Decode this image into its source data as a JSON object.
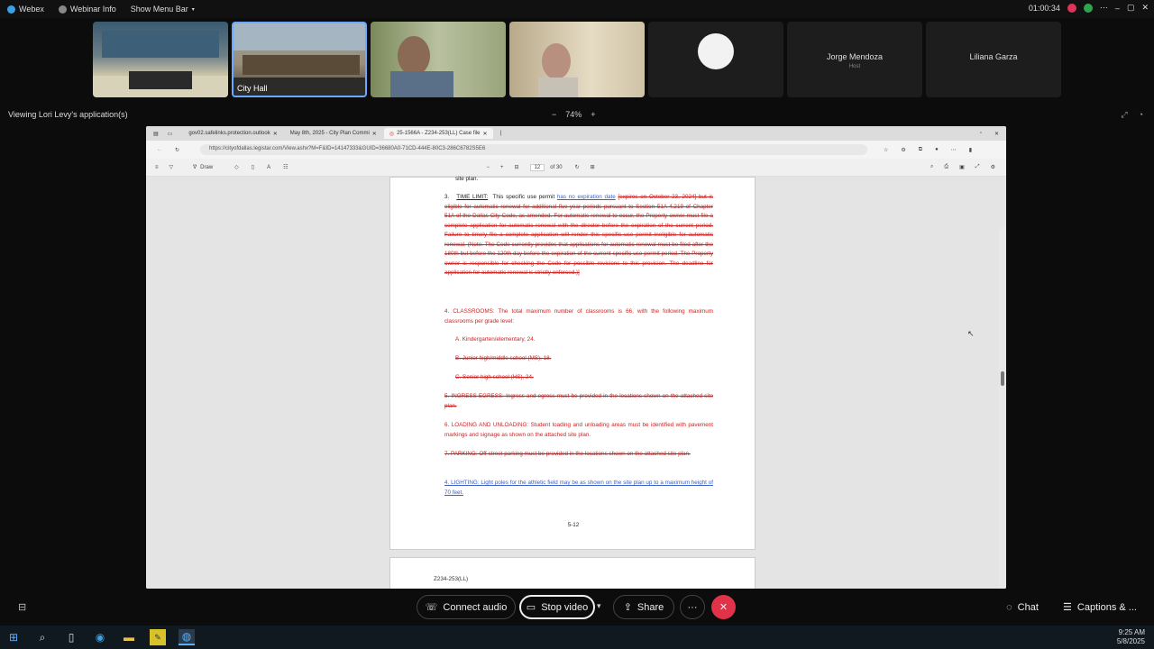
{
  "topbar": {
    "menus": [
      "Webex",
      "Webinar Info",
      "Show Menu Bar"
    ],
    "timer": "01:00:34"
  },
  "participants": [
    {
      "label": "",
      "type": "video-room"
    },
    {
      "label": "City Hall",
      "type": "video-room"
    },
    {
      "label": "",
      "type": "video-person"
    },
    {
      "label": "",
      "type": "video-person"
    },
    {
      "label": "",
      "type": "avatar"
    },
    {
      "name": "Jorge Mendoza",
      "role": "Host"
    },
    {
      "name": "Liliana Garza"
    }
  ],
  "share": {
    "viewing_label": "Viewing Lori Levy's application(s)",
    "zoom_level": "74%",
    "zoom_minus": "−",
    "zoom_plus": "+"
  },
  "browser": {
    "tabs": [
      "gov02.safelinks.protection.outlook",
      "May 8th, 2025 - City Plan Commi",
      "25-1566A - Z234-253(LL) Case file"
    ],
    "url": "https://cityofdallas.legistar.com/View.ashx?M=F&ID=14147333&GUID=36680A0-71CD-444E-80C3-286C6782S5E6",
    "pdf": {
      "draw_label": "Draw",
      "page_current": "12",
      "page_total": "of 30"
    }
  },
  "document": {
    "top_fragment": "site plan.",
    "item3_num": "3.",
    "item3_title": "TIME LIMIT:",
    "item3_lead": "This specific use permit",
    "item3_added": "has no expiration date",
    "item3_struck": "[expires on October 23, 2024] but is eligible for automatic renewal for additional five-year periods pursuant to Section 51A-4.219 of Chapter 51A of the Dallas City Code, as amended. For automatic renewal to occur, the Property owner must file a complete application for automatic renewal with the director before the expiration of the current period. Failure to timely file a complete application will render this specific use permit ineligible for automatic renewal. (Note: The Code currently provides that applications for automatic renewal must be filed after the 180th but before the 120th day before the expiration of the current specific use permit period. The Property owner is responsible for checking the Code for possible revisions to this provision. The deadline for application for automatic renewal is strictly enforced.)]",
    "item4": "4. CLASSROOMS: The total maximum number of classrooms is 66, with the following maximum classrooms per grade level:",
    "item4a": "A.  Kindergarten/elementary, 24.",
    "item4b": "B.  Junior high/middle school (MS), 18.",
    "item4c": "C.  Senior high school (HS), 24.",
    "item5": "5. INGRESS-EGRESS: Ingress and egress must be provided in the locations shown on the attached site plan.",
    "item6": "6. LOADING AND UNLOADING: Student loading and unloading areas must be identified with pavement markings and signage as shown on the attached site plan.",
    "item7": "7. PARKING: Off-street parking must be provided in the locations shown on the attached site plan.",
    "item8": "4. LIGHTING: Light poles for the athletic field may be as shown on the site plan up to a maximum height of 70 feet.",
    "page_number": "5-12",
    "next_page_header": "Z234-253(LL)"
  },
  "controls": {
    "connect_audio": "Connect audio",
    "stop_video": "Stop video",
    "share": "Share",
    "more": "···",
    "chat": "Chat",
    "captions": "Captions & ..."
  },
  "taskbar": {
    "time": "9:25 AM",
    "date": "5/8/2025"
  },
  "colors": {
    "end_call": "#e0334a",
    "strike_red": "#cc2222",
    "added_blue": "#3b5fc4"
  }
}
